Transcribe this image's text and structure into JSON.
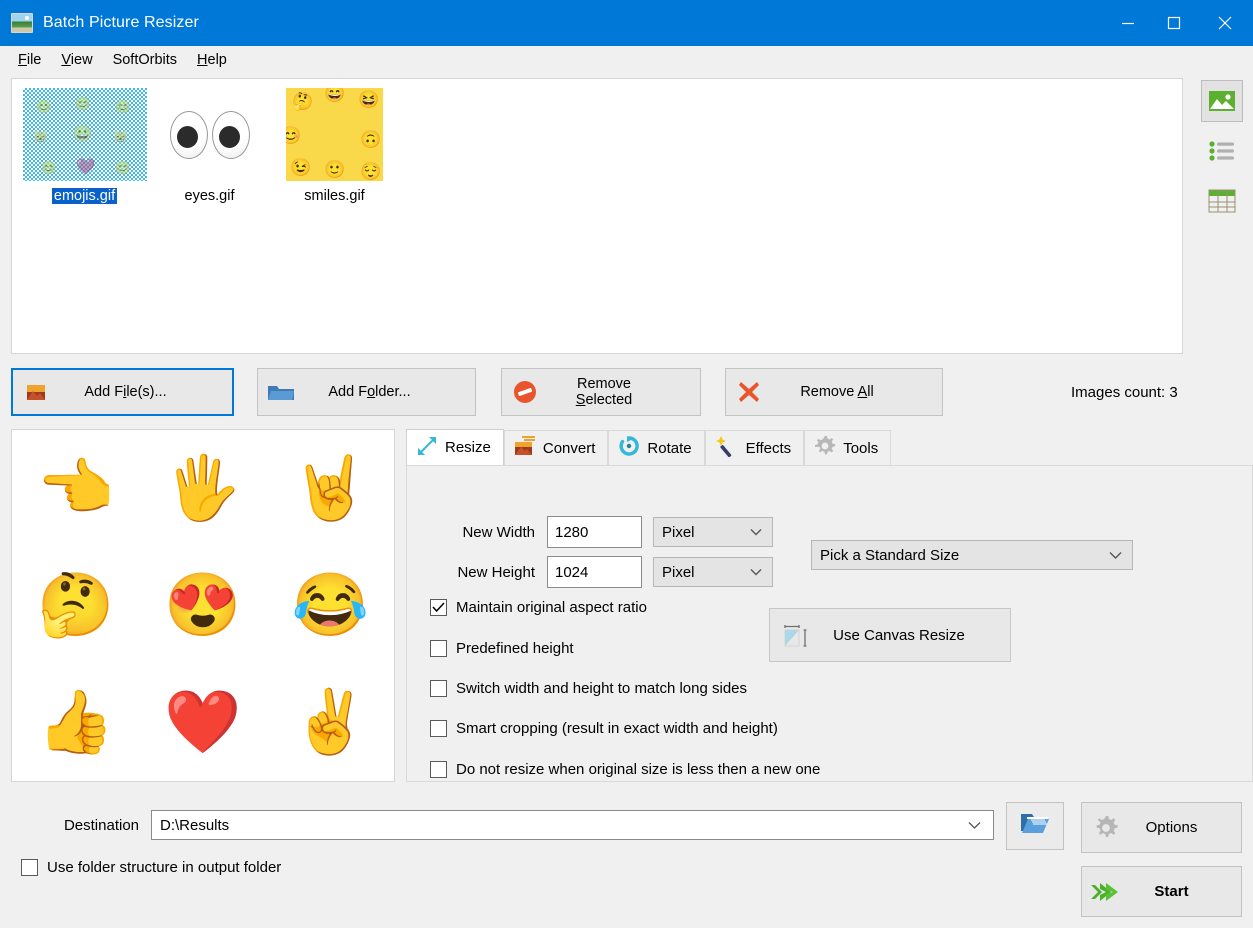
{
  "window": {
    "title": "Batch Picture Resizer",
    "icon": "picture-frame-icon",
    "minimize": "–",
    "maximize": "□",
    "close": "✕"
  },
  "menu": {
    "items": [
      {
        "label": "File",
        "accel": "F"
      },
      {
        "label": "View",
        "accel": "V"
      },
      {
        "label": "SoftOrbits",
        "accel": ""
      },
      {
        "label": "Help",
        "accel": "H"
      }
    ]
  },
  "file_list": {
    "items": [
      {
        "name": "emojis.gif",
        "selected": true,
        "thumb": "checkered-emoji-sheet"
      },
      {
        "name": "eyes.gif",
        "selected": false,
        "thumb": "googly-eyes"
      },
      {
        "name": "smiles.gif",
        "selected": false,
        "thumb": "yellow-smiles-sheet"
      }
    ]
  },
  "view_modes": [
    {
      "name": "thumbnail-view",
      "active": true
    },
    {
      "name": "list-view",
      "active": false
    },
    {
      "name": "details-view",
      "active": false
    }
  ],
  "actions": {
    "add_files": {
      "label_pre": "Add F",
      "accel": "i",
      "label_post": "le(s)..."
    },
    "add_folder": {
      "label_pre": "Add F",
      "accel": "o",
      "label_post": "lder..."
    },
    "remove_selected": {
      "label_pre": "Remove ",
      "accel": "S",
      "label_post": "elected"
    },
    "remove_all": {
      "label_pre": "Remove ",
      "accel": "A",
      "label_post": "ll"
    },
    "images_count": "Images count: 3"
  },
  "preview": {
    "emojis": [
      "👈",
      "🖐",
      "🤘",
      "🤔",
      "😍",
      "😂",
      "👍",
      "❤️",
      "✌️"
    ]
  },
  "tabs": [
    {
      "label": "Resize",
      "icon": "resize-arrows-icon",
      "active": true
    },
    {
      "label": "Convert",
      "icon": "convert-image-icon",
      "active": false
    },
    {
      "label": "Rotate",
      "icon": "rotate-icon",
      "active": false
    },
    {
      "label": "Effects",
      "icon": "magic-wand-icon",
      "active": false
    },
    {
      "label": "Tools",
      "icon": "gear-icon",
      "active": false
    }
  ],
  "resize": {
    "new_width_label": "New Width",
    "new_width_value": "1280",
    "new_width_unit": "Pixel",
    "new_height_label": "New Height",
    "new_height_value": "1024",
    "new_height_unit": "Pixel",
    "standard_size": "Pick a Standard Size",
    "canvas_resize": "Use Canvas Resize",
    "checkboxes": [
      {
        "label": "Maintain original aspect ratio",
        "checked": true
      },
      {
        "label": "Predefined height",
        "checked": false
      },
      {
        "label": "Switch width and height to match long sides",
        "checked": false
      },
      {
        "label": "Smart cropping (result in exact width and height)",
        "checked": false
      },
      {
        "label": "Do not resize when original size is less then a new one",
        "checked": false
      }
    ]
  },
  "bottom": {
    "destination_label": "Destination",
    "destination_value": "D:\\Results",
    "browse_icon": "open-folder-icon",
    "folder_structure_label": "Use folder structure in output folder",
    "folder_structure_checked": false,
    "options_label": "Options",
    "start_label": "Start"
  },
  "colors": {
    "titlebar": "#0078d7",
    "window_bg": "#f0f0f0",
    "accent_focus": "#0078d7",
    "selection": "#0a61c9",
    "start_green": "#4caf2a",
    "remove_red": "#e8552d"
  }
}
